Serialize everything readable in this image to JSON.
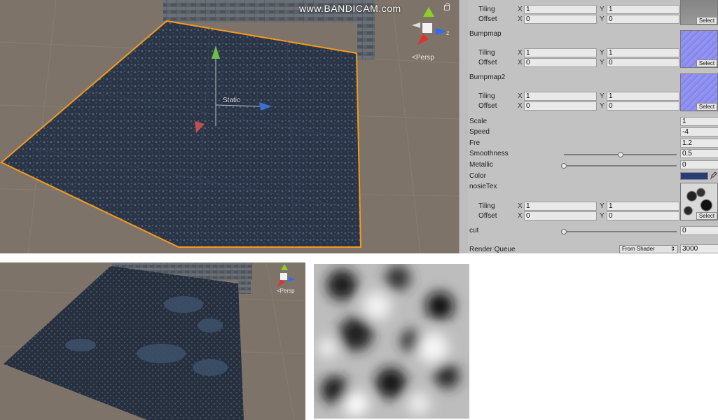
{
  "watermark": "www.BANDICAM.com",
  "scene": {
    "static_label": "Static",
    "persp_label": "Persp",
    "gizmo_axis_z": "z"
  },
  "inspector": {
    "tiling_label": "Tiling",
    "offset_label": "Offset",
    "x_axis": "X",
    "y_axis": "Y",
    "select_label": "Select",
    "textures": [
      {
        "name": "",
        "tiling_x": "1",
        "tiling_y": "1",
        "offset_x": "0",
        "offset_y": "0",
        "icon": "gray-texture"
      },
      {
        "name": "Bumpmap",
        "tiling_x": "1",
        "tiling_y": "1",
        "offset_x": "0",
        "offset_y": "0",
        "icon": "normal-map-texture"
      },
      {
        "name": "Bumpmap2",
        "tiling_x": "1",
        "tiling_y": "1",
        "offset_x": "0",
        "offset_y": "0",
        "icon": "normal-map-texture"
      }
    ],
    "scale": {
      "label": "Scale",
      "value": "1"
    },
    "speed": {
      "label": "Speed",
      "value": "-4"
    },
    "fre": {
      "label": "Fre",
      "value": "1.2"
    },
    "smoothness": {
      "label": "Smoothness",
      "value": "0.5",
      "level": 0.5
    },
    "metallic": {
      "label": "Metallic",
      "value": "0",
      "level": 0
    },
    "color": {
      "label": "Color",
      "swatch": "#2a3c76"
    },
    "noise_tex": {
      "name": "nosieTex",
      "tiling_x": "1",
      "tiling_y": "1",
      "offset_x": "0",
      "offset_y": "0"
    },
    "cut": {
      "label": "cut",
      "value": "0",
      "level": 0
    },
    "render_queue": {
      "label": "Render Queue",
      "mode": "From Shader",
      "value": "3000"
    }
  },
  "bottom": {
    "persp_label": "Persp"
  }
}
